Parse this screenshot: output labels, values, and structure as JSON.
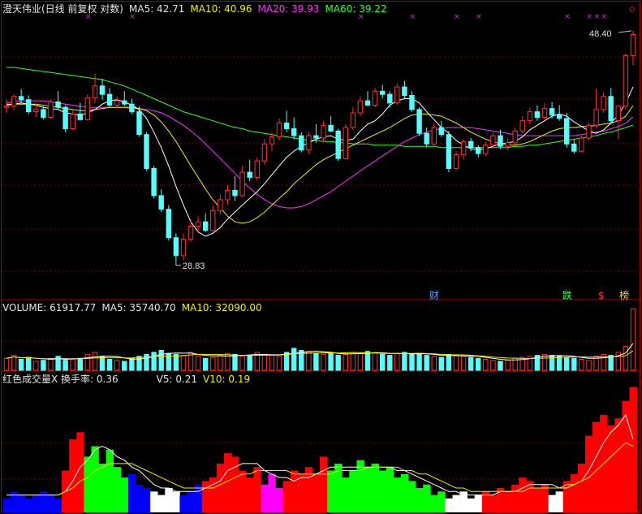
{
  "main_header": {
    "title": "澄天伟业(日线 前复权 对数)",
    "ma5": "MA5: 42.71",
    "ma10": "MA10: 40.96",
    "ma20": "MA20: 39.93",
    "ma60": "MA60: 39.22"
  },
  "volume_header": {
    "volume": "VOLUME: 61917.77",
    "ma5": "MA5: 35740.70",
    "ma10": "MA10: 32090.00"
  },
  "turnover_header": {
    "label": "红色成交量X 换手率: 0.36",
    "v5": "V5: 0.21",
    "v10": "V10: 0.19"
  },
  "event_flags": {
    "cai": "财",
    "die": "跌",
    "s": "$",
    "bang": "榜"
  },
  "colors": {
    "up": "#ff3030",
    "down": "#54ffff",
    "ma5": "#ffffff",
    "ma10": "#f0f000",
    "ma20": "#ff30ff",
    "ma60": "#30ff30",
    "grid": "#800000",
    "flag": "#cc33cc"
  },
  "chart_data": [
    {
      "type": "candlestick",
      "scale": "log",
      "price_labels": {
        "high": "48.40",
        "low": "28.83"
      },
      "ylim": [
        27,
        50
      ],
      "ohlc": [
        [
          40.8,
          41.5,
          40.3,
          40.9
        ],
        [
          40.9,
          42.0,
          40.6,
          41.8
        ],
        [
          41.8,
          42.5,
          41.2,
          41.5
        ],
        [
          41.5,
          41.9,
          40.2,
          40.4
        ],
        [
          40.4,
          41.1,
          39.9,
          40.6
        ],
        [
          40.6,
          40.9,
          39.7,
          39.9
        ],
        [
          39.9,
          41.5,
          39.8,
          41.3
        ],
        [
          41.3,
          42.3,
          40.6,
          40.8
        ],
        [
          40.8,
          41.0,
          38.6,
          38.9
        ],
        [
          38.9,
          40.6,
          38.8,
          40.2
        ],
        [
          40.2,
          41.2,
          39.6,
          39.7
        ],
        [
          39.7,
          42.0,
          39.6,
          41.7
        ],
        [
          41.7,
          44.0,
          41.2,
          42.8
        ],
        [
          42.8,
          43.5,
          41.5,
          42.0
        ],
        [
          42.0,
          42.6,
          40.8,
          41.0
        ],
        [
          41.0,
          41.8,
          40.7,
          41.4
        ],
        [
          41.4,
          42.3,
          40.9,
          41.1
        ],
        [
          41.1,
          41.6,
          40.2,
          40.4
        ],
        [
          40.4,
          40.9,
          38.2,
          38.4
        ],
        [
          38.4,
          38.6,
          35.4,
          35.6
        ],
        [
          35.6,
          35.8,
          33.3,
          33.5
        ],
        [
          33.5,
          34.0,
          32.3,
          32.5
        ],
        [
          32.5,
          32.8,
          30.3,
          30.5
        ],
        [
          30.5,
          30.8,
          28.83,
          29.3
        ],
        [
          29.3,
          30.8,
          29.0,
          30.4
        ],
        [
          30.4,
          31.8,
          30.2,
          31.3
        ],
        [
          31.3,
          32.0,
          30.8,
          31.6
        ],
        [
          31.6,
          32.2,
          30.9,
          31.0
        ],
        [
          31.0,
          32.8,
          30.9,
          32.4
        ],
        [
          32.4,
          33.6,
          32.1,
          33.2
        ],
        [
          33.2,
          34.3,
          32.9,
          33.9
        ],
        [
          33.9,
          35.0,
          33.1,
          33.5
        ],
        [
          33.5,
          35.8,
          33.4,
          35.3
        ],
        [
          35.3,
          36.3,
          34.6,
          34.9
        ],
        [
          34.9,
          36.5,
          34.7,
          36.2
        ],
        [
          36.2,
          38.0,
          35.9,
          37.6
        ],
        [
          37.6,
          38.6,
          37.0,
          38.2
        ],
        [
          38.2,
          39.8,
          37.9,
          39.4
        ],
        [
          39.4,
          40.5,
          38.6,
          38.9
        ],
        [
          38.9,
          39.9,
          38.0,
          38.3
        ],
        [
          38.3,
          38.6,
          36.9,
          37.1
        ],
        [
          37.1,
          38.6,
          36.8,
          38.3
        ],
        [
          38.3,
          39.3,
          37.7,
          38.1
        ],
        [
          38.1,
          39.6,
          37.8,
          39.2
        ],
        [
          39.2,
          40.0,
          38.6,
          38.7
        ],
        [
          38.7,
          38.9,
          36.2,
          36.4
        ],
        [
          36.4,
          39.3,
          36.3,
          39.0
        ],
        [
          39.0,
          40.8,
          38.8,
          40.3
        ],
        [
          40.3,
          41.8,
          40.0,
          41.4
        ],
        [
          41.4,
          42.3,
          40.9,
          41.0
        ],
        [
          41.0,
          42.6,
          40.8,
          42.3
        ],
        [
          42.3,
          42.9,
          41.6,
          42.0
        ],
        [
          42.0,
          42.3,
          40.8,
          41.2
        ],
        [
          41.2,
          43.0,
          41.0,
          42.7
        ],
        [
          42.7,
          43.3,
          41.6,
          41.9
        ],
        [
          41.9,
          42.3,
          40.4,
          40.6
        ],
        [
          40.6,
          40.8,
          38.3,
          38.5
        ],
        [
          38.5,
          39.0,
          37.3,
          37.6
        ],
        [
          37.6,
          39.4,
          37.4,
          39.0
        ],
        [
          39.0,
          39.6,
          38.2,
          38.4
        ],
        [
          38.4,
          38.7,
          35.3,
          35.6
        ],
        [
          35.6,
          37.0,
          35.4,
          36.7
        ],
        [
          36.7,
          38.0,
          36.3,
          37.8
        ],
        [
          37.8,
          38.1,
          37.0,
          37.3
        ],
        [
          37.3,
          37.5,
          36.5,
          36.8
        ],
        [
          36.8,
          37.8,
          36.6,
          37.5
        ],
        [
          37.5,
          38.6,
          37.3,
          38.3
        ],
        [
          38.3,
          38.8,
          37.2,
          37.4
        ],
        [
          37.4,
          38.0,
          37.1,
          37.7
        ],
        [
          37.7,
          39.0,
          37.5,
          38.7
        ],
        [
          38.7,
          40.0,
          38.5,
          39.6
        ],
        [
          39.6,
          40.8,
          39.3,
          40.4
        ],
        [
          40.4,
          41.0,
          39.6,
          39.9
        ],
        [
          39.9,
          41.2,
          39.7,
          40.7
        ],
        [
          40.7,
          41.3,
          39.8,
          40.1
        ],
        [
          40.1,
          41.0,
          39.6,
          39.8
        ],
        [
          39.8,
          40.3,
          37.3,
          37.6
        ],
        [
          37.6,
          38.0,
          36.8,
          37.0
        ],
        [
          37.0,
          38.3,
          36.9,
          38.1
        ],
        [
          38.1,
          39.4,
          37.9,
          39.2
        ],
        [
          39.2,
          42.5,
          39.0,
          40.6
        ],
        [
          40.6,
          42.2,
          40.3,
          41.8
        ],
        [
          41.8,
          42.6,
          39.3,
          39.6
        ],
        [
          39.6,
          41.0,
          38.0,
          40.9
        ],
        [
          40.9,
          46.0,
          40.6,
          45.8
        ],
        [
          45.8,
          48.4,
          44.8,
          48.0
        ]
      ],
      "ma5": [
        41.0,
        41.1,
        41.2,
        41.1,
        41.0,
        40.8,
        40.7,
        40.6,
        40.3,
        40.2,
        40.1,
        40.3,
        40.6,
        41.1,
        41.4,
        41.5,
        41.3,
        41.0,
        40.6,
        39.8,
        38.6,
        37.3,
        35.8,
        34.2,
        32.8,
        31.6,
        30.9,
        30.6,
        30.8,
        31.2,
        31.8,
        32.3,
        32.8,
        33.3,
        33.8,
        34.4,
        35.1,
        35.8,
        36.5,
        37.0,
        37.4,
        37.7,
        38.0,
        38.2,
        38.3,
        38.0,
        37.9,
        38.0,
        38.7,
        39.3,
        39.6,
        40.2,
        41.0,
        41.4,
        41.6,
        41.6,
        41.2,
        40.4,
        39.7,
        39.0,
        38.5,
        37.9,
        37.5,
        37.2,
        37.1,
        37.2,
        37.4,
        37.6,
        37.7,
        37.8,
        38.2,
        38.8,
        39.2,
        39.6,
        40.0,
        40.2,
        40.0,
        39.5,
        39.1,
        38.7,
        38.5,
        38.8,
        39.4,
        40.1,
        41.2,
        42.7
      ],
      "ma10": [
        41.1,
        41.1,
        41.1,
        41.1,
        41.1,
        41.0,
        40.9,
        40.8,
        40.7,
        40.6,
        40.5,
        40.5,
        40.6,
        40.7,
        40.8,
        40.8,
        40.8,
        40.8,
        40.7,
        40.5,
        40.1,
        39.5,
        38.7,
        37.8,
        36.8,
        35.8,
        34.9,
        34.0,
        33.2,
        32.6,
        32.0,
        31.6,
        31.5,
        31.6,
        31.9,
        32.3,
        32.8,
        33.3,
        33.8,
        34.4,
        34.9,
        35.4,
        35.9,
        36.3,
        36.6,
        36.9,
        37.2,
        37.5,
        37.8,
        38.1,
        38.4,
        38.7,
        39.0,
        39.4,
        39.8,
        40.1,
        40.2,
        40.2,
        40.1,
        40.0,
        39.7,
        39.4,
        39.0,
        38.6,
        38.3,
        38.0,
        37.8,
        37.6,
        37.5,
        37.5,
        37.6,
        37.8,
        38.1,
        38.4,
        38.7,
        38.9,
        39.0,
        39.0,
        39.1,
        39.1,
        39.2,
        39.3,
        39.4,
        39.6,
        40.0,
        40.96
      ],
      "ma20": [
        41.2,
        41.3,
        41.4,
        41.4,
        41.4,
        41.4,
        41.3,
        41.2,
        41.1,
        41.0,
        40.9,
        40.8,
        40.8,
        40.8,
        40.8,
        40.8,
        40.8,
        40.7,
        40.7,
        40.6,
        40.5,
        40.3,
        40.0,
        39.6,
        39.2,
        38.7,
        38.2,
        37.6,
        37.0,
        36.4,
        35.8,
        35.2,
        34.6,
        34.1,
        33.6,
        33.2,
        32.9,
        32.7,
        32.6,
        32.6,
        32.7,
        32.9,
        33.2,
        33.5,
        33.8,
        34.2,
        34.6,
        35.0,
        35.4,
        35.8,
        36.2,
        36.6,
        37.0,
        37.4,
        37.8,
        38.1,
        38.4,
        38.6,
        38.8,
        38.9,
        39.0,
        39.0,
        39.0,
        39.0,
        38.9,
        38.8,
        38.7,
        38.6,
        38.5,
        38.4,
        38.3,
        38.3,
        38.3,
        38.3,
        38.3,
        38.3,
        38.3,
        38.3,
        38.4,
        38.5,
        38.6,
        38.7,
        38.9,
        39.1,
        39.4,
        39.93
      ],
      "ma60": [
        44.6,
        44.6,
        44.5,
        44.4,
        44.3,
        44.2,
        44.1,
        44.0,
        43.9,
        43.8,
        43.7,
        43.6,
        43.5,
        43.4,
        43.2,
        43.0,
        42.8,
        42.5,
        42.2,
        41.9,
        41.6,
        41.3,
        41.0,
        40.7,
        40.4,
        40.2,
        40.0,
        39.8,
        39.6,
        39.4,
        39.2,
        39.0,
        38.9,
        38.7,
        38.6,
        38.5,
        38.4,
        38.3,
        38.2,
        38.1,
        38.0,
        37.9,
        37.9,
        37.8,
        37.8,
        37.7,
        37.7,
        37.6,
        37.6,
        37.6,
        37.5,
        37.5,
        37.5,
        37.5,
        37.4,
        37.4,
        37.4,
        37.4,
        37.4,
        37.3,
        37.3,
        37.3,
        37.3,
        37.3,
        37.3,
        37.3,
        37.3,
        37.3,
        37.3,
        37.4,
        37.4,
        37.5,
        37.5,
        37.6,
        37.7,
        37.8,
        37.9,
        38.0,
        38.1,
        38.2,
        38.3,
        38.5,
        38.6,
        38.8,
        39.0,
        39.22
      ]
    },
    {
      "type": "bar",
      "name": "VOLUME",
      "ylim": [
        0,
        62000
      ],
      "values": [
        12,
        15,
        11,
        13,
        9,
        10,
        12,
        14,
        10,
        11,
        12,
        16,
        18,
        14,
        11,
        10,
        9,
        12,
        14,
        16,
        18,
        20,
        17,
        16,
        15,
        18,
        14,
        12,
        13,
        15,
        17,
        16,
        14,
        15,
        18,
        16,
        15,
        14,
        18,
        22,
        20,
        19,
        17,
        16,
        18,
        15,
        16,
        18,
        17,
        19,
        18,
        16,
        15,
        17,
        18,
        16,
        17,
        15,
        14,
        13,
        16,
        15,
        14,
        13,
        12,
        11,
        10,
        9,
        10,
        12,
        13,
        14,
        15,
        16,
        15,
        14,
        13,
        12,
        11,
        10,
        14,
        16,
        15,
        18,
        24,
        62
      ]
    },
    {
      "type": "bar",
      "name": "换手率",
      "ylim": [
        0,
        0.38
      ],
      "values": [
        0.04,
        0.06,
        0.05,
        0.04,
        0.05,
        0.06,
        0.05,
        0.04,
        0.12,
        0.21,
        0.23,
        0.16,
        0.19,
        0.14,
        0.18,
        0.13,
        0.1,
        0.11,
        0.08,
        0.07,
        0.06,
        0.05,
        0.07,
        0.06,
        0.05,
        0.06,
        0.08,
        0.09,
        0.1,
        0.14,
        0.17,
        0.16,
        0.12,
        0.1,
        0.13,
        0.08,
        0.11,
        0.07,
        0.09,
        0.12,
        0.11,
        0.13,
        0.11,
        0.16,
        0.12,
        0.14,
        0.1,
        0.12,
        0.15,
        0.13,
        0.14,
        0.12,
        0.13,
        0.1,
        0.11,
        0.09,
        0.07,
        0.08,
        0.05,
        0.06,
        0.04,
        0.05,
        0.06,
        0.04,
        0.05,
        0.06,
        0.05,
        0.07,
        0.06,
        0.08,
        0.1,
        0.09,
        0.07,
        0.08,
        0.05,
        0.06,
        0.09,
        0.11,
        0.14,
        0.22,
        0.26,
        0.28,
        0.25,
        0.27,
        0.32,
        0.36
      ],
      "v5": [
        0.05,
        0.05,
        0.05,
        0.05,
        0.05,
        0.05,
        0.05,
        0.05,
        0.06,
        0.09,
        0.13,
        0.15,
        0.18,
        0.19,
        0.18,
        0.16,
        0.15,
        0.13,
        0.12,
        0.1,
        0.08,
        0.07,
        0.07,
        0.06,
        0.06,
        0.06,
        0.06,
        0.07,
        0.08,
        0.09,
        0.12,
        0.13,
        0.14,
        0.14,
        0.14,
        0.12,
        0.11,
        0.1,
        0.1,
        0.09,
        0.1,
        0.1,
        0.11,
        0.12,
        0.13,
        0.13,
        0.13,
        0.13,
        0.13,
        0.13,
        0.13,
        0.13,
        0.13,
        0.12,
        0.12,
        0.11,
        0.1,
        0.09,
        0.08,
        0.07,
        0.06,
        0.06,
        0.05,
        0.05,
        0.05,
        0.05,
        0.05,
        0.06,
        0.06,
        0.06,
        0.07,
        0.08,
        0.08,
        0.08,
        0.08,
        0.07,
        0.07,
        0.08,
        0.09,
        0.12,
        0.16,
        0.2,
        0.23,
        0.25,
        0.28,
        0.21
      ],
      "v10": [
        0.05,
        0.05,
        0.05,
        0.05,
        0.05,
        0.05,
        0.05,
        0.05,
        0.06,
        0.07,
        0.09,
        0.1,
        0.12,
        0.13,
        0.14,
        0.14,
        0.14,
        0.14,
        0.13,
        0.12,
        0.11,
        0.1,
        0.09,
        0.08,
        0.07,
        0.07,
        0.07,
        0.07,
        0.07,
        0.08,
        0.09,
        0.1,
        0.11,
        0.11,
        0.12,
        0.12,
        0.12,
        0.12,
        0.12,
        0.11,
        0.11,
        0.11,
        0.11,
        0.11,
        0.11,
        0.12,
        0.12,
        0.12,
        0.12,
        0.13,
        0.13,
        0.13,
        0.13,
        0.13,
        0.12,
        0.12,
        0.11,
        0.11,
        0.1,
        0.09,
        0.08,
        0.07,
        0.07,
        0.06,
        0.06,
        0.06,
        0.06,
        0.06,
        0.06,
        0.06,
        0.06,
        0.07,
        0.07,
        0.07,
        0.07,
        0.07,
        0.08,
        0.08,
        0.09,
        0.1,
        0.12,
        0.14,
        0.16,
        0.18,
        0.2,
        0.19
      ],
      "bar_colors": [
        "#0000ff",
        "#0000ff",
        "#0000ff",
        "#0000ff",
        "#0000ff",
        "#0000ff",
        "#0000ff",
        "#0000ff",
        "#ff0000",
        "#ff0000",
        "#ff0000",
        "#00ff00",
        "#00ff00",
        "#00ff00",
        "#00ff00",
        "#00ff00",
        "#00ff00",
        "#0000ff",
        "#0000ff",
        "#0000ff",
        "#ffffff",
        "#ffffff",
        "#ffffff",
        "#ffffff",
        "#0000ff",
        "#0000ff",
        "#0000ff",
        "#ff0000",
        "#ff0000",
        "#ff0000",
        "#ff0000",
        "#ff0000",
        "#ff0000",
        "#ff0000",
        "#ff0000",
        "#ff00ff",
        "#ff00ff",
        "#ff00ff",
        "#ff0000",
        "#ff0000",
        "#ff0000",
        "#ff0000",
        "#ff0000",
        "#ff0000",
        "#00ff00",
        "#00ff00",
        "#00ff00",
        "#00ff00",
        "#00ff00",
        "#00ff00",
        "#00ff00",
        "#00ff00",
        "#00ff00",
        "#00ff00",
        "#00ff00",
        "#00ff00",
        "#00ff00",
        "#00ff00",
        "#00ff00",
        "#00ff00",
        "#ffffff",
        "#ffffff",
        "#ffffff",
        "#ffffff",
        "#ffffff",
        "#ff0000",
        "#ff0000",
        "#ff0000",
        "#ff0000",
        "#ff0000",
        "#ff0000",
        "#ff0000",
        "#ff0000",
        "#ff0000",
        "#ffffff",
        "#ffffff",
        "#ff0000",
        "#ff0000",
        "#ff0000",
        "#ff0000",
        "#ff0000",
        "#ff0000",
        "#ff0000",
        "#ff0000",
        "#ff0000",
        "#ff0000"
      ]
    }
  ]
}
